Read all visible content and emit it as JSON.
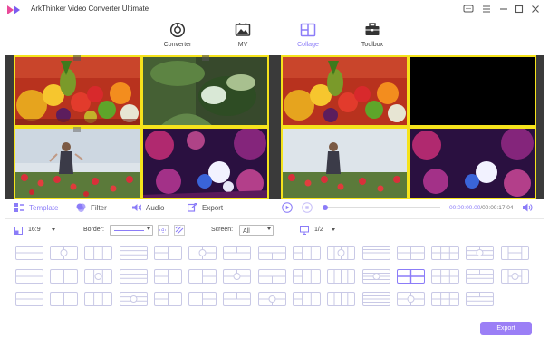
{
  "app": {
    "title": "ArkThinker Video Converter Ultimate"
  },
  "nav": {
    "items": [
      {
        "label": "Converter"
      },
      {
        "label": "MV"
      },
      {
        "label": "Collage"
      },
      {
        "label": "Toolbox"
      }
    ]
  },
  "tools": {
    "template": "Template",
    "filter": "Filter",
    "audio": "Audio",
    "export": "Export"
  },
  "player": {
    "current": "00:00:00.00",
    "total": "00:00:17.04",
    "separator": "/",
    "progress": 0.0
  },
  "options": {
    "ratio": "16:9",
    "border_label": "Border:",
    "screen_label": "Screen:",
    "screen_value": "All",
    "page": "1/2"
  },
  "export_button": "Export",
  "colors": {
    "accent": "#8b7cf8",
    "selection": "#f5e31c",
    "button": "#9b7ff6"
  }
}
